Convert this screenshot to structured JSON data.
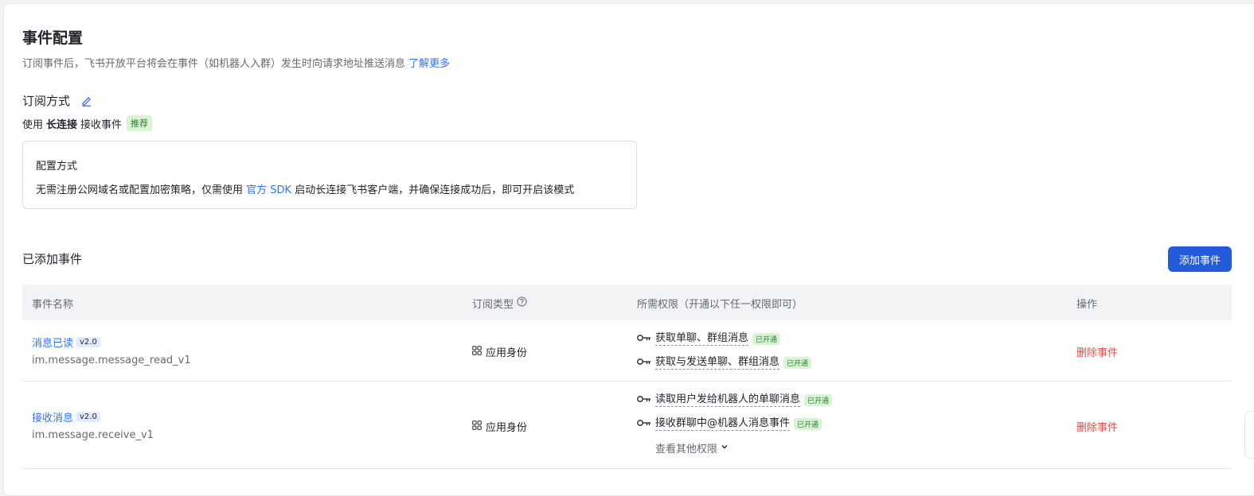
{
  "header": {
    "title": "事件配置",
    "desc_prefix": "订阅事件后，飞书开放平台将会在事件（如机器人入群）发生时向请求地址推送消息",
    "learn_more": "了解更多"
  },
  "subscription": {
    "title": "订阅方式",
    "line_prefix": "使用",
    "line_bold": "长连接",
    "line_suffix": "接收事件",
    "tag": "推荐"
  },
  "config": {
    "title": "配置方式",
    "text_prefix": "无需注册公网域名或配置加密策略，仅需使用",
    "sdk_link": "官方 SDK",
    "text_suffix": "启动长连接飞书客户端，并确保连接成功后，即可开启该模式"
  },
  "events": {
    "title": "已添加事件",
    "add_button": "添加事件",
    "columns": {
      "name": "事件名称",
      "type": "订阅类型",
      "perms": "所需权限（开通以下任一权限即可）",
      "ops": "操作"
    },
    "rows": [
      {
        "name": "消息已读",
        "version": "v2.0",
        "key": "im.message.message_read_v1",
        "type": "应用身份",
        "perms": [
          {
            "label": "获取单聊、群组消息",
            "status": "已开通"
          },
          {
            "label": "获取与发送单聊、群组消息",
            "status": "已开通"
          }
        ],
        "action": "删除事件"
      },
      {
        "name": "接收消息",
        "version": "v2.0",
        "key": "im.message.receive_v1",
        "type": "应用身份",
        "perms": [
          {
            "label": "读取用户发给机器人的单聊消息",
            "status": "已开通"
          },
          {
            "label": "接收群聊中@机器人消息事件",
            "status": "已开通"
          }
        ],
        "more": "查看其他权限",
        "action": "删除事件"
      }
    ]
  },
  "colors": {
    "primary": "#245bdb",
    "link": "#3370ff",
    "danger": "#f54a45",
    "success_bg": "#d9f5d6",
    "success_text": "#2e7d32"
  }
}
